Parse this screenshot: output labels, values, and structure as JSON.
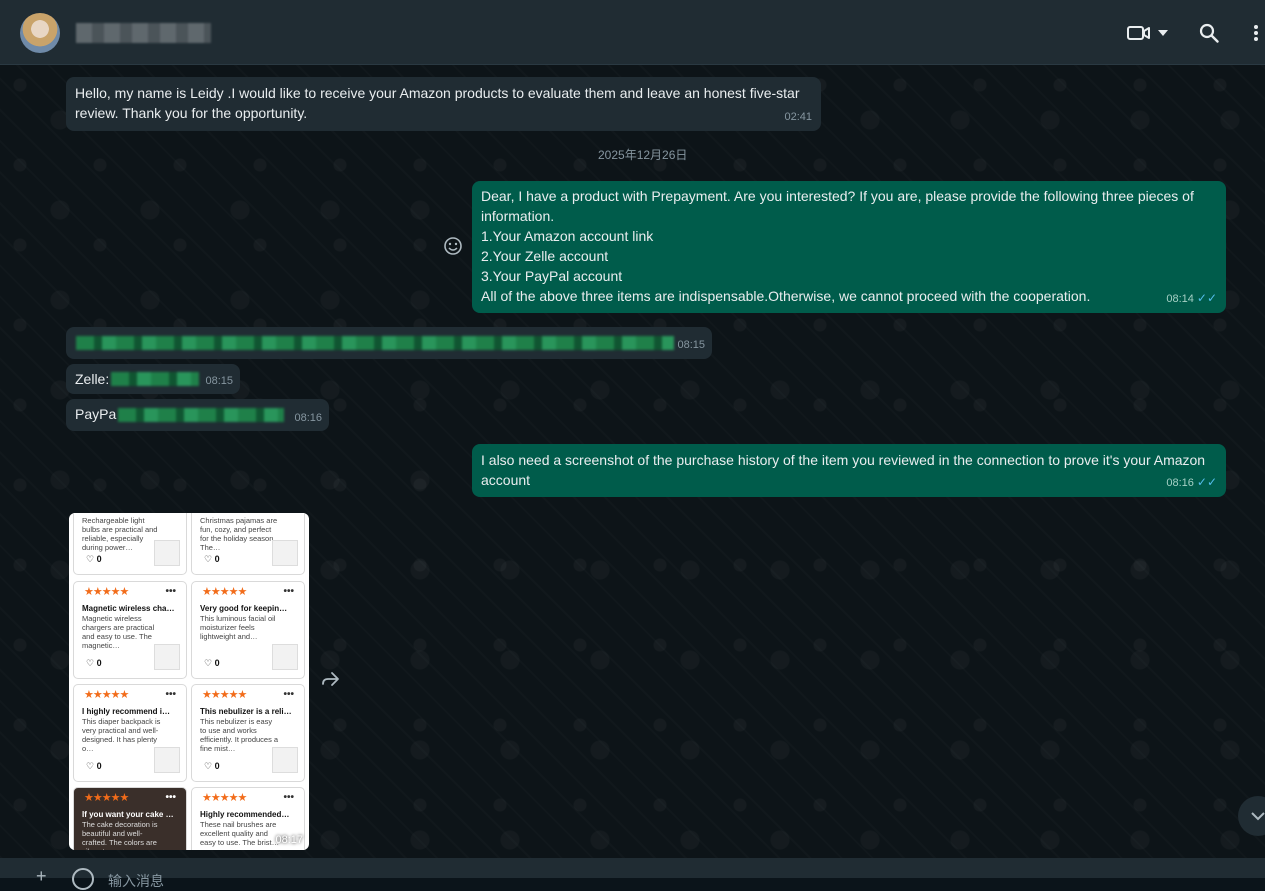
{
  "header": {
    "video_icon": "video-camera-icon",
    "search_icon": "search-icon",
    "menu_icon": "kebab-menu-icon"
  },
  "messages": [
    {
      "text": "Hello, my name is Leidy .I would like to receive your Amazon products to evaluate them and leave an honest five-star review. Thank you for the opportunity.",
      "time": "02:41",
      "direction": "in"
    },
    {
      "date": "2025年12月26日"
    },
    {
      "lines": [
        "Dear, I have a product with Prepayment. Are you interested? If you are, please provide the following three pieces of information.",
        "1.Your Amazon account link",
        "2.Your Zelle account",
        "3.Your PayPal account",
        "All of the above three items are indispensable.Otherwise, we cannot proceed with the cooperation."
      ],
      "time": "08:14",
      "direction": "out",
      "ticks": "✓✓"
    },
    {
      "text": "",
      "time": "08:15",
      "direction": "in"
    },
    {
      "text": "Zelle:",
      "time": "08:15",
      "direction": "in"
    },
    {
      "text": "PayPa",
      "time": "08:16",
      "direction": "in"
    },
    {
      "text": "I also need a screenshot of the purchase history of the item you reviewed in the connection to prove it's your Amazon account",
      "time": "08:16",
      "direction": "out",
      "ticks": "✓✓"
    },
    {
      "time": "08:17",
      "direction": "in",
      "type": "image"
    }
  ],
  "review_cards": [
    {
      "stars": "",
      "title": "",
      "desc": "Rechargeable light bulbs are practical and reliable, especially during power…",
      "likes": "0"
    },
    {
      "stars": "",
      "title": "",
      "desc": "Christmas pajamas are fun, cozy, and perfect for the holiday season. The…",
      "likes": "0"
    },
    {
      "stars": "★★★★★",
      "title": "Magnetic wireless cha…",
      "desc": "Magnetic wireless chargers are practical and easy to use. The magnetic…",
      "likes": "0"
    },
    {
      "stars": "★★★★★",
      "title": "Very good for keepin…",
      "desc": "This luminous facial oil moisturizer feels lightweight and…",
      "likes": "0"
    },
    {
      "stars": "★★★★★",
      "title": "I highly recommend i…",
      "desc": "This diaper backpack is very practical and well-designed. It has plenty o…",
      "likes": "0"
    },
    {
      "stars": "★★★★★",
      "title": "This nebulizer is a reli…",
      "desc": "This nebulizer is easy to use and works efficiently. It produces a fine mist…",
      "likes": "0"
    },
    {
      "stars": "★★★★★",
      "title": "If you want your cake …",
      "desc": "The cake decoration is beautiful and well-crafted. The colors are vibrant…",
      "likes": ""
    },
    {
      "stars": "★★★★★",
      "title": "Highly recommended…",
      "desc": "These nail brushes are excellent quality and easy to use. The brist…",
      "likes": ""
    }
  ],
  "input": {
    "placeholder": "输入消息"
  }
}
